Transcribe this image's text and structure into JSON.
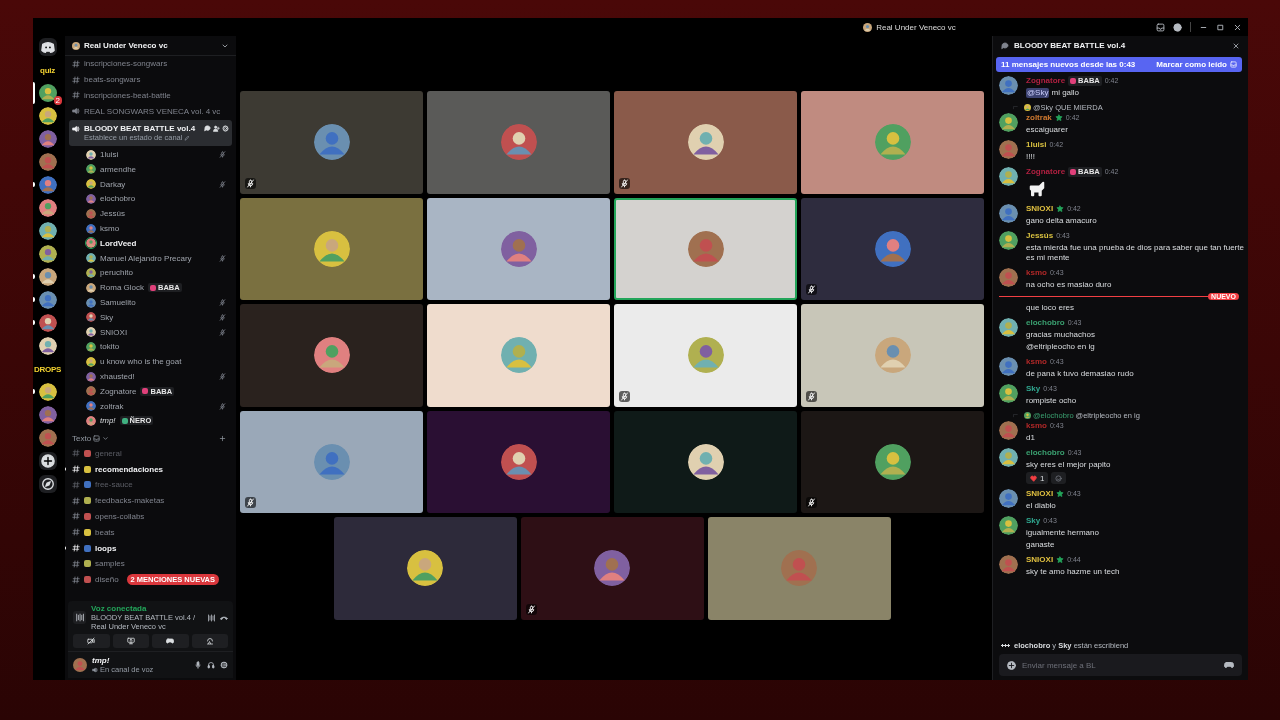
{
  "window": {
    "title": "Real Under Veneco vc"
  },
  "servers": [
    {
      "kind": "home",
      "selected": false,
      "unread": false
    },
    {
      "kind": "label",
      "label": "quiz",
      "selected": false,
      "unread": false
    },
    {
      "kind": "icon",
      "selected": true,
      "unread": false,
      "badge": "2"
    },
    {
      "kind": "icon",
      "selected": false,
      "unread": false
    },
    {
      "kind": "icon",
      "selected": false,
      "unread": false
    },
    {
      "kind": "icon",
      "selected": false,
      "unread": false
    },
    {
      "kind": "icon",
      "selected": false,
      "unread": true
    },
    {
      "kind": "icon",
      "selected": false,
      "unread": false
    },
    {
      "kind": "icon",
      "selected": false,
      "unread": false
    },
    {
      "kind": "icon",
      "selected": false,
      "unread": false
    },
    {
      "kind": "icon",
      "selected": false,
      "unread": true
    },
    {
      "kind": "icon",
      "selected": false,
      "unread": true
    },
    {
      "kind": "icon",
      "selected": false,
      "unread": true
    },
    {
      "kind": "icon",
      "selected": false,
      "unread": false
    },
    {
      "kind": "label",
      "label": "DROPS",
      "selected": false,
      "unread": false
    },
    {
      "kind": "icon",
      "selected": false,
      "unread": true
    },
    {
      "kind": "icon",
      "selected": false,
      "unread": false
    },
    {
      "kind": "icon",
      "selected": false,
      "unread": false
    },
    {
      "kind": "add",
      "selected": false,
      "unread": false
    },
    {
      "kind": "discover",
      "selected": false,
      "unread": false
    }
  ],
  "server_header": {
    "name": "Real Under Veneco vc"
  },
  "channels": [
    {
      "kind": "text",
      "name": "inscripciones-songwars",
      "unread": false,
      "muted": false,
      "selected": false
    },
    {
      "kind": "text",
      "name": "beats-songwars",
      "unread": false,
      "muted": false,
      "selected": false
    },
    {
      "kind": "text",
      "name": "inscripciones-beat-battle",
      "unread": false,
      "muted": false,
      "selected": false
    },
    {
      "kind": "voice",
      "name": "REAL SONGWARS VENECA vol. 4 vc",
      "unread": false,
      "muted": false,
      "selected": false
    },
    {
      "kind": "voice",
      "name": "BLOODY BEAT BATTLE vol.4",
      "status": "Establece un estado de canal",
      "unread": false,
      "muted": false,
      "selected": true
    }
  ],
  "members": [
    {
      "name": "1luisi",
      "muted": true,
      "speaking": false,
      "self": false
    },
    {
      "name": "armendhe",
      "muted": false,
      "speaking": false,
      "self": false
    },
    {
      "name": "Darkay",
      "muted": true,
      "speaking": false,
      "self": false
    },
    {
      "name": "elochobro",
      "muted": false,
      "speaking": false,
      "self": false
    },
    {
      "name": "Jessús",
      "muted": false,
      "speaking": false,
      "self": false
    },
    {
      "name": "ksmo",
      "muted": false,
      "speaking": false,
      "self": false
    },
    {
      "name": "LordVeed",
      "muted": false,
      "speaking": true,
      "self": false
    },
    {
      "name": "Manuel Alejandro Precary",
      "muted": true,
      "speaking": false,
      "self": false
    },
    {
      "name": "peruchito",
      "muted": false,
      "speaking": false,
      "self": false
    },
    {
      "name": "Roma Glock",
      "muted": false,
      "speaking": false,
      "self": false,
      "badge": {
        "text": "BABA",
        "color": "#e0407a"
      }
    },
    {
      "name": "Samuelito",
      "muted": true,
      "speaking": false,
      "self": false
    },
    {
      "name": "Sky",
      "muted": true,
      "speaking": false,
      "self": false
    },
    {
      "name": "SNIOXI",
      "muted": true,
      "speaking": false,
      "self": false
    },
    {
      "name": "tokito",
      "muted": false,
      "speaking": false,
      "self": false
    },
    {
      "name": "u know who is the goat",
      "muted": false,
      "speaking": false,
      "self": false
    },
    {
      "name": "xhausted!",
      "muted": true,
      "speaking": false,
      "self": false
    },
    {
      "name": "Zognatore",
      "muted": false,
      "speaking": false,
      "self": false,
      "badge": {
        "text": "BABA",
        "color": "#e0407a"
      }
    },
    {
      "name": "zoltrak",
      "muted": true,
      "speaking": false,
      "self": false
    },
    {
      "name": "tmp!",
      "muted": false,
      "speaking": false,
      "self": true,
      "badge": {
        "text": "ÑERO",
        "color": "#40b080"
      }
    }
  ],
  "category": {
    "name": "Texto",
    "expanded": true
  },
  "text_channels": [
    {
      "name": "general",
      "unread": false,
      "muted": true
    },
    {
      "name": "recomendaciones",
      "unread": true,
      "muted": false
    },
    {
      "name": "free-sauce",
      "unread": false,
      "muted": true
    },
    {
      "name": "feedbacks-maketas",
      "unread": false,
      "muted": false
    },
    {
      "name": "opens-collabs",
      "unread": false,
      "muted": false
    },
    {
      "name": "beats",
      "unread": false,
      "muted": false
    },
    {
      "name": "loops",
      "unread": true,
      "muted": false
    },
    {
      "name": "samples",
      "unread": false,
      "muted": false
    },
    {
      "name": "diseño",
      "unread": false,
      "muted": false
    }
  ],
  "mentions_badge": "2 MENCIONES NUEVAS",
  "voice_panel": {
    "status": "Voz conectada",
    "channel": "BLOODY BEAT BATTLE vol.4 / Real Under Veneco vc"
  },
  "user_panel": {
    "name": "tmp!",
    "status": "En canal de voz"
  },
  "tiles": [
    {
      "color": "#3d3a33",
      "muted": true,
      "speaking": false
    },
    {
      "color": "#5a5a58",
      "muted": false,
      "speaking": false
    },
    {
      "color": "#8a5a4a",
      "muted": true,
      "speaking": false
    },
    {
      "color": "#c08b80",
      "muted": false,
      "speaking": false
    },
    {
      "color": "#7a7040",
      "muted": false,
      "speaking": false
    },
    {
      "color": "#a9b5c4",
      "muted": false,
      "speaking": false
    },
    {
      "color": "#d4d2cf",
      "muted": false,
      "speaking": true
    },
    {
      "color": "#2e2c3e",
      "muted": true,
      "speaking": false
    },
    {
      "color": "#2a221e",
      "muted": false,
      "speaking": false
    },
    {
      "color": "#efdccd",
      "muted": false,
      "speaking": false
    },
    {
      "color": "#ebebeb",
      "muted": true,
      "speaking": false
    },
    {
      "color": "#c8c6b8",
      "muted": true,
      "speaking": false
    },
    {
      "color": "#9aa8b8",
      "muted": true,
      "speaking": false
    },
    {
      "color": "#2a0f33",
      "muted": false,
      "speaking": false
    },
    {
      "color": "#0f1a18",
      "muted": false,
      "speaking": false
    },
    {
      "color": "#1c1715",
      "muted": true,
      "speaking": false
    },
    {
      "color": "#2d2a3a",
      "muted": false,
      "speaking": false
    },
    {
      "color": "#2e0f15",
      "muted": true,
      "speaking": false
    },
    {
      "color": "#8a8468",
      "muted": false,
      "speaking": false
    }
  ],
  "chat": {
    "title": "BLOODY BEAT BATTLE vol.4",
    "banner": {
      "text": "11 mensajes nuevos desde las 0:43",
      "action": "Marcar como leído"
    },
    "messages": [
      {
        "kind": "message",
        "author": "Zognatore",
        "color": "#b02040",
        "badge": {
          "text": "BABA",
          "color": "#e0407a"
        },
        "role_icon": false,
        "time": "0:42",
        "mention": "@Sky",
        "lines": [
          "mi gallo"
        ]
      },
      {
        "kind": "message",
        "author": "zoltrak",
        "color": "#d07a30",
        "role_icon": true,
        "time": "0:42",
        "reply": "@Sky QUE MIERDA",
        "lines": [
          "escaiguarer"
        ]
      },
      {
        "kind": "message",
        "author": "1luisi",
        "color": "#d8c040",
        "role_icon": false,
        "time": "0:42",
        "lines": [
          "!!!!"
        ]
      },
      {
        "kind": "sticker",
        "author": "Zognatore",
        "color": "#b02040",
        "badge": {
          "text": "BABA",
          "color": "#e0407a"
        },
        "role_icon": false,
        "time": "0:42"
      },
      {
        "kind": "message",
        "author": "SNIOXI",
        "color": "#e0c040",
        "role_icon": true,
        "time": "0:42",
        "lines": [
          "gano delta amacuro"
        ]
      },
      {
        "kind": "message",
        "author": "Jessús",
        "color": "#d8c040",
        "role_icon": false,
        "time": "0:43",
        "lines": [
          "esta mierda fue una prueba de dios para saber que tan fuerte es mi mente"
        ]
      },
      {
        "kind": "message",
        "author": "ksmo",
        "color": "#b02828",
        "role_icon": false,
        "time": "0:43",
        "lines": [
          "na ocho es masiao duro"
        ]
      },
      {
        "kind": "divider",
        "label": "NUEVO"
      },
      {
        "kind": "continuation",
        "lines": [
          "que loco eres"
        ]
      },
      {
        "kind": "message",
        "author": "elochobro",
        "color": "#3aa070",
        "role_icon": false,
        "time": "0:43",
        "lines": [
          "gracias muchachos",
          "@eltripleocho en ig"
        ]
      },
      {
        "kind": "message",
        "author": "ksmo",
        "color": "#b02828",
        "role_icon": false,
        "time": "0:43",
        "lines": [
          "de pana k tuvo demasiao rudo"
        ]
      },
      {
        "kind": "message",
        "author": "Sky",
        "color": "#30a890",
        "role_icon": false,
        "time": "0:43",
        "lines": [
          "rompiste ocho"
        ]
      },
      {
        "kind": "message",
        "author": "ksmo",
        "color": "#b02828",
        "role_icon": false,
        "time": "0:43",
        "reply_mention": "@elochobro",
        "reply": "@eltripleocho en ig",
        "lines": [
          "d1"
        ]
      },
      {
        "kind": "message",
        "author": "elochobro",
        "color": "#3aa070",
        "role_icon": false,
        "time": "0:43",
        "lines": [
          "sky eres el mejor papito"
        ],
        "reaction_count": "1"
      },
      {
        "kind": "message",
        "author": "SNIOXI",
        "color": "#e0c040",
        "role_icon": true,
        "time": "0:43",
        "lines": [
          "el diablo"
        ]
      },
      {
        "kind": "message",
        "author": "Sky",
        "color": "#30a890",
        "role_icon": false,
        "time": "0:43",
        "lines": [
          "igualmente hermano",
          "ganaste"
        ]
      },
      {
        "kind": "message",
        "author": "SNIOXI",
        "color": "#e0c040",
        "role_icon": true,
        "time": "0:44",
        "lines": [
          "sky te amo hazme un tech"
        ]
      }
    ],
    "typing": "**elochobro** y **Sky** están escribiend",
    "input": {
      "placeholder": "Enviar mensaje a BL"
    }
  }
}
